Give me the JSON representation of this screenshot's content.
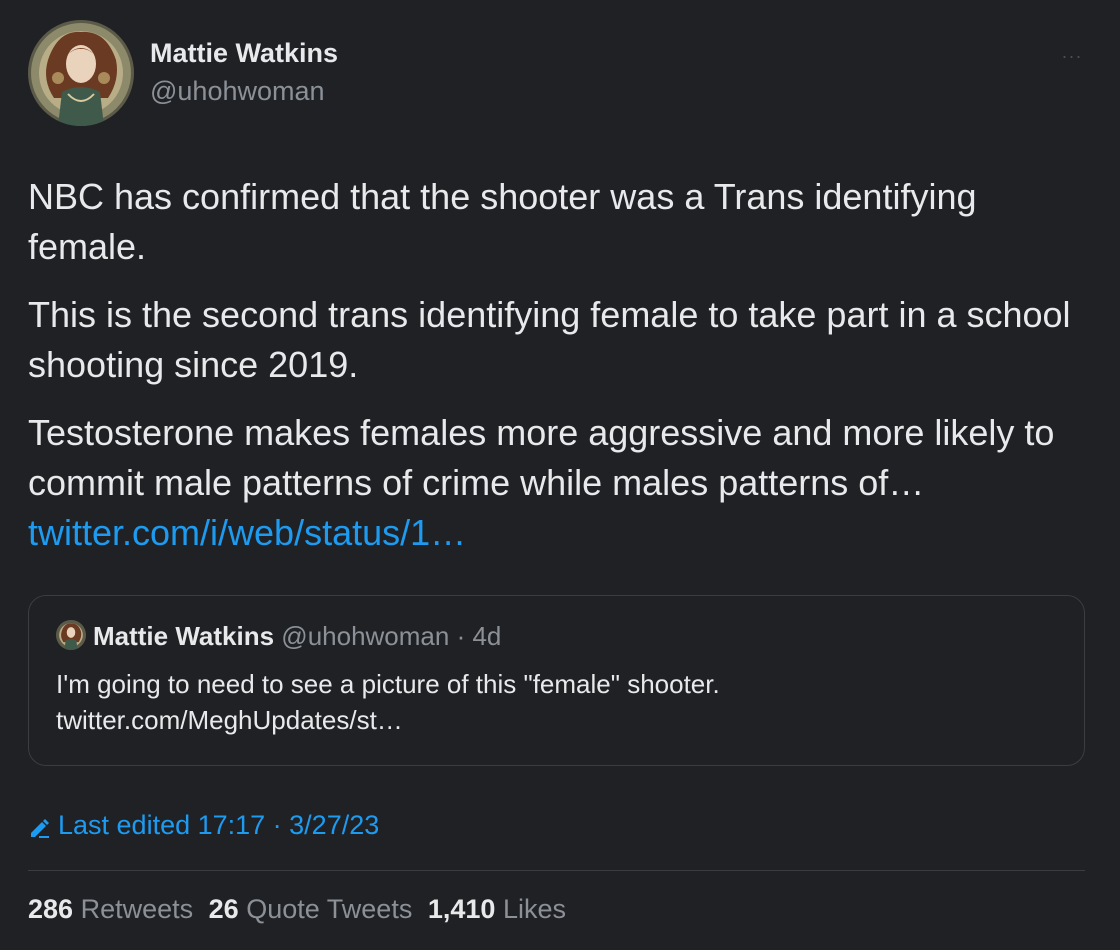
{
  "author": {
    "name": "Mattie Watkins",
    "handle": "@uhohwoman",
    "avatar_icon": "profile-avatar-art-nouveau-portrait"
  },
  "menu": {
    "more_icon": "more-horizontal-icon",
    "more_glyph": "···"
  },
  "tweet": {
    "paragraphs": [
      "NBC has confirmed that the shooter was a Trans identifying female.",
      "This is the second trans identifying female to take part in a school shooting since 2019.",
      "Testosterone makes females more aggressive and more likely to commit male patterns of crime while males patterns of…"
    ],
    "link_text": "twitter.com/i/web/status/1…"
  },
  "quote": {
    "name": "Mattie Watkins",
    "handle": "@uhohwoman",
    "time": "· 4d",
    "text": "I'm going to need to see a picture of this \"female\" shooter. twitter.com/MeghUpdates/st…"
  },
  "edit": {
    "icon": "pencil-icon",
    "label": "Last edited 17:17 · 3/27/23"
  },
  "stats": {
    "retweets": {
      "count": "286",
      "label": "Retweets"
    },
    "quotes": {
      "count": "26",
      "label": "Quote Tweets"
    },
    "likes": {
      "count": "1,410",
      "label": "Likes"
    }
  },
  "colors": {
    "background": "#202125",
    "text": "#e7e9ea",
    "secondary": "#8b9197",
    "accent": "#1d9bf0",
    "border": "#3a3d42"
  }
}
